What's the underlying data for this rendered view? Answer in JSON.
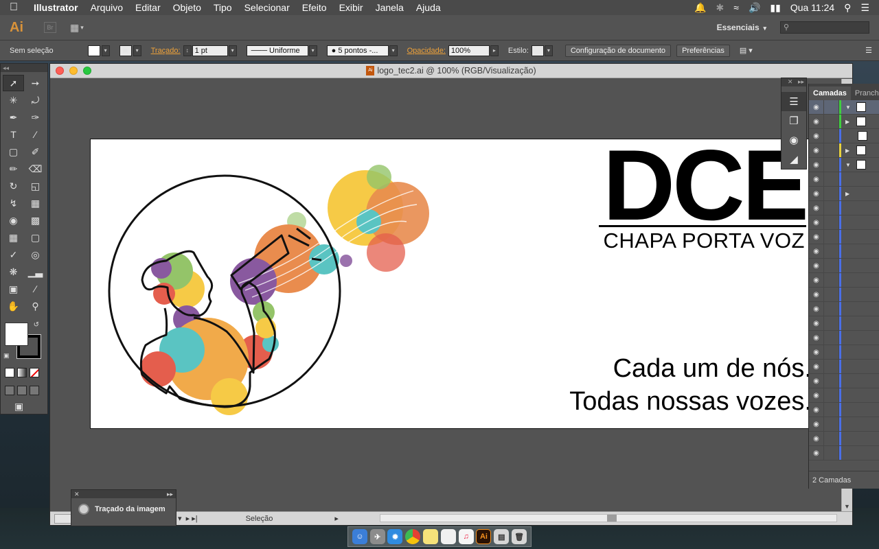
{
  "menubar": {
    "apple": "",
    "app_name": "Illustrator",
    "items": [
      "Arquivo",
      "Editar",
      "Objeto",
      "Tipo",
      "Selecionar",
      "Efeito",
      "Exibir",
      "Janela",
      "Ajuda"
    ],
    "clock": "Qua 11:24"
  },
  "appbar": {
    "logo": "Ai",
    "bridge": "Br",
    "workspace": "Essenciais"
  },
  "control": {
    "selection": "Sem seleção",
    "stroke_label": "Traçado:",
    "stroke_value": "1 pt",
    "profile": "Uniforme",
    "brush": "5 pontos -...",
    "opacity_label": "Opacidade:",
    "opacity_value": "100%",
    "style_label": "Estilo:",
    "doc_setup": "Configuração de documento",
    "preferences": "Preferências"
  },
  "document": {
    "title": "logo_tec2.ai @ 100% (RGB/Visualização)",
    "file_icon": "Ai",
    "status": "Seleção"
  },
  "artwork": {
    "headline": "DCE",
    "subtitle": "CHAPA PORTA VOZ",
    "slogan_line1": "Cada um de nós.",
    "slogan_line2": "Todas nossas vozes."
  },
  "layers": {
    "tab_active": "Camadas",
    "tab_other": "Pranchetas",
    "footer": "2 Camadas"
  },
  "trace": {
    "label": "Traçado da imagem"
  },
  "colors": {
    "accent_orange": "#f0a33a",
    "illustration_yellow": "#f6c636",
    "illustration_orange": "#e7823f",
    "illustration_teal": "#4cbfbd",
    "illustration_purple": "#7f4b97",
    "illustration_green": "#8bbf5c",
    "illustration_red": "#e2503e"
  }
}
